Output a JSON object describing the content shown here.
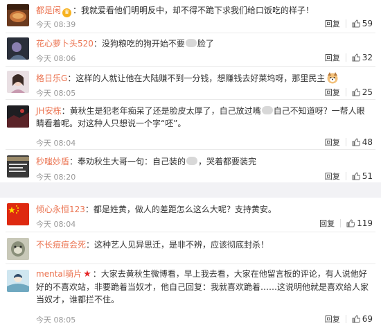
{
  "comments_top": [
    {
      "user": "都是闲",
      "badge": "vip",
      "text_parts": [
        "：我就爱看他们明明反中，却不得不跪下求我们给口饭吃的样子！"
      ],
      "time": "今天 08:39",
      "reply": "回复",
      "likes": "59"
    },
    {
      "user": "花心萝卜头520",
      "text_parts": [
        "：没狗粮吃的狗开始不要",
        "",
        "脸了"
      ],
      "time": "今天 08:06",
      "reply": "回复",
      "likes": "32"
    },
    {
      "user": "格日乐G",
      "text_parts": [
        "：这样的人就让他在大陆赚不到一分钱，想赚钱去好莱坞呀，那里民主"
      ],
      "time": "今天 08:05",
      "reply": "回复",
      "likes": "25"
    },
    {
      "user": "JH安栋",
      "text_parts": [
        "：黄秋生是犯老年痴呆了还是脸皮太厚了，自己放过嘴",
        "",
        "自己不知道呀？一帮人眼睛看着呢。对这种人只想说一个字“呸”。"
      ],
      "time": "今天 08:04",
      "reply": "回复",
      "likes": "48"
    },
    {
      "user": "秒嗤妙盾",
      "text_parts": [
        "：奉劝秋生大哥一句：自己装的",
        "",
        "，哭着都要装完"
      ],
      "time": "今天 08:20",
      "reply": "回复",
      "likes": "51"
    }
  ],
  "comments_bottom": [
    {
      "user": "倾心永恒123",
      "text_parts": [
        "：都是姓黄，做人的差距怎么这么大呢？支持黄安。"
      ],
      "time": "今天 08:04",
      "reply": "回复",
      "likes": "119"
    },
    {
      "user": "不长痘痘会死",
      "text_parts": [
        "：这种艺人见异思迁，是非不辨，应该彻底封杀！"
      ],
      "time": "",
      "reply": "",
      "likes": ""
    },
    {
      "user": "mental骑片",
      "badge": "star",
      "text_parts": [
        "：大家去黄秋生微博看，早上我去看，大家在他留言板的评论，有人说他好好的不喜欢站，非要跪着当奴才，他自己回复：我就喜欢跪着……这说明他就是喜欢给人家当奴才，谁都拦不住。"
      ],
      "time": "今天 08:05",
      "reply": "回复",
      "likes": "69"
    }
  ],
  "colors": {
    "username": "#eb7350",
    "text": "#333333",
    "time": "#999999",
    "vip_badge": "#f7b21f",
    "star": "#e52626"
  },
  "icons": {
    "like": "thumbs-up-icon",
    "vip": "vip-crown-icon",
    "star": "red-star-icon",
    "emoji": "dog-emoji-icon"
  }
}
